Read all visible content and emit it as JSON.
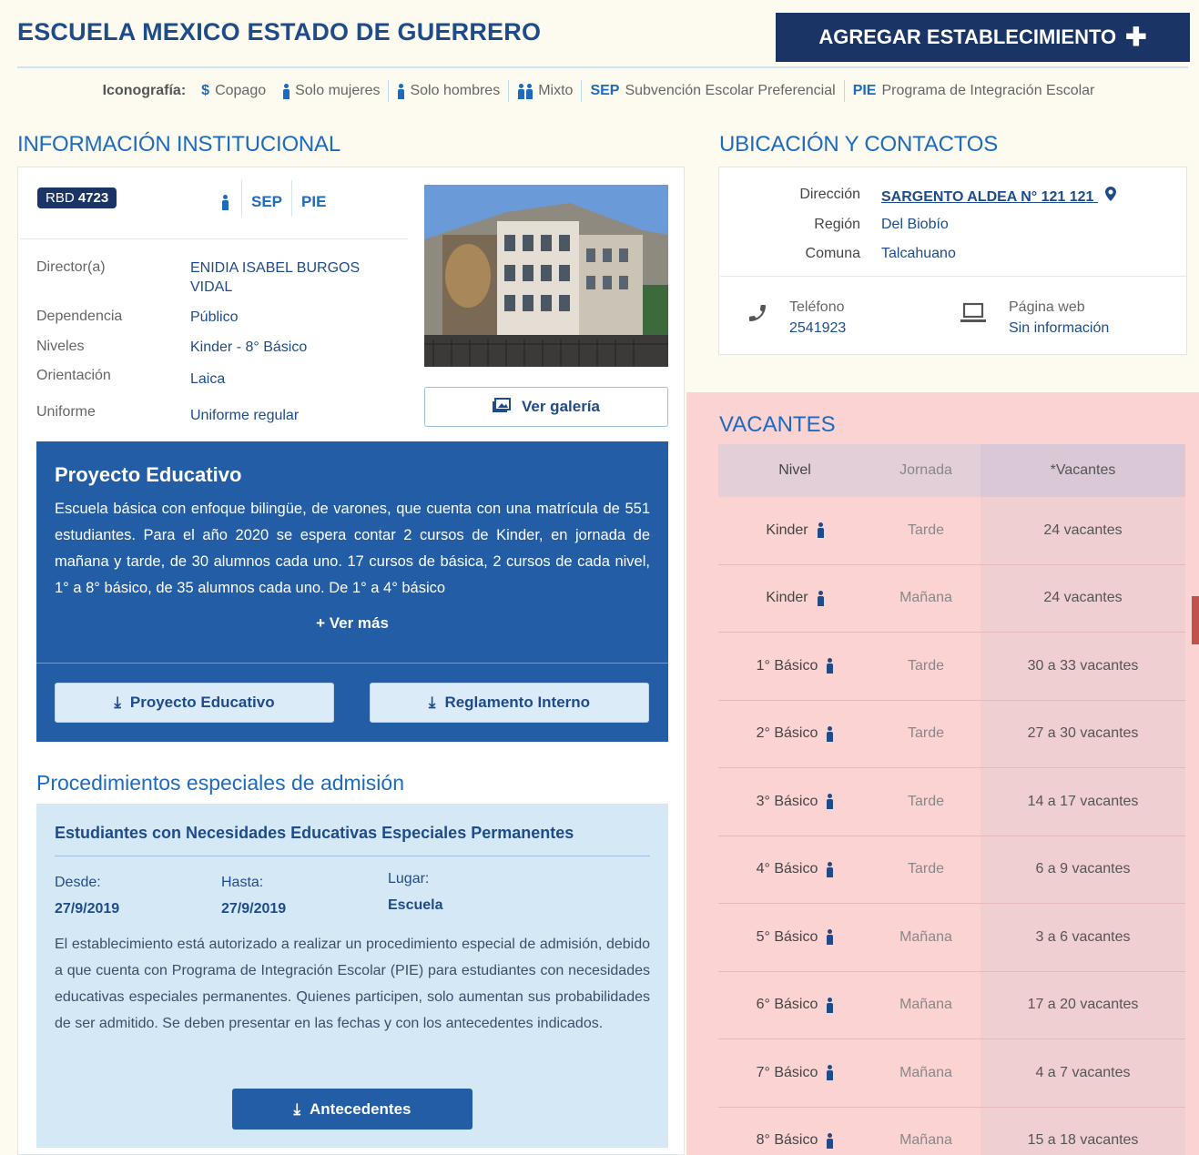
{
  "header": {
    "school_name": "ESCUELA MEXICO ESTADO DE GUERRERO",
    "add_button_label": "AGREGAR ESTABLECIMIENTO"
  },
  "legend": {
    "label": "Iconografía:",
    "copago": "Copago",
    "solo_mujeres": "Solo mujeres",
    "solo_hombres": "Solo hombres",
    "mixto": "Mixto",
    "sep_code": "SEP",
    "sep_text": "Subvención Escolar Preferencial",
    "pie_code": "PIE",
    "pie_text": "Programa de Integración Escolar"
  },
  "institutional": {
    "heading": "INFORMACIÓN INSTITUCIONAL",
    "rbd_label": "RBD",
    "rbd_value": "4723",
    "badge_sep": "SEP",
    "badge_pie": "PIE",
    "rows": [
      {
        "label": "Director(a)",
        "value": "ENIDIA ISABEL BURGOS VIDAL"
      },
      {
        "label": "Dependencia",
        "value": "Público"
      },
      {
        "label": "Niveles",
        "value": "Kinder - 8° Básico"
      },
      {
        "label": "Orientación",
        "value": "Laica"
      },
      {
        "label": "Uniforme",
        "value": "Uniforme regular"
      }
    ],
    "gallery_button": "Ver galería"
  },
  "project": {
    "title": "Proyecto Educativo",
    "text": "Escuela básica con enfoque bilingüe, de varones, que cuenta con una matrícula de 551 estudiantes. Para el año 2020 se espera contar 2 cursos de Kinder, en jornada de mañana y tarde, de 30 alumnos cada uno. 17 cursos de básica, 2 cursos de cada nivel, 1° a 8° básico, de 35 alumnos cada uno. De 1° a 4° básico",
    "more": "+ Ver más",
    "btn_project": "Proyecto Educativo",
    "btn_rules": "Reglamento Interno"
  },
  "procedures": {
    "heading": "Procedimientos especiales de admisión",
    "title": "Estudiantes con Necesidades Educativas Especiales Permanentes",
    "from_label": "Desde:",
    "from_value": "27/9/2019",
    "to_label": "Hasta:",
    "to_value": "27/9/2019",
    "place_label": "Lugar:",
    "place_value": "Escuela",
    "text": "El establecimiento está autorizado a realizar un procedimiento especial de admisión, debido a que cuenta con Programa de Integración Escolar (PIE) para estudiantes con necesidades educativas especiales permanentes. Quienes participen, solo aumentan sus probabilidades de ser admitido. Se deben presentar en las fechas y con los antecedentes indicados.",
    "button": "Antecedentes"
  },
  "contacts": {
    "heading": "UBICACIÓN Y CONTACTOS",
    "address_label": "Dirección",
    "address_value": "SARGENTO ALDEA N° 121 121",
    "region_label": "Región",
    "region_value": "Del Biobío",
    "comuna_label": "Comuna",
    "comuna_value": "Talcahuano",
    "phone_label": "Teléfono",
    "phone_value": "2541923",
    "web_label": "Página web",
    "web_value": "Sin información"
  },
  "vacancies": {
    "heading": "VACANTES",
    "columns": [
      "Nivel",
      "Jornada",
      "*Vacantes"
    ],
    "rows": [
      {
        "level": "Kinder",
        "shift": "Tarde",
        "vacancies": "24 vacantes"
      },
      {
        "level": "Kinder",
        "shift": "Mañana",
        "vacancies": "24 vacantes"
      },
      {
        "level": "1° Básico",
        "shift": "Tarde",
        "vacancies": "30 a 33 vacantes"
      },
      {
        "level": "2° Básico",
        "shift": "Tarde",
        "vacancies": "27 a 30 vacantes"
      },
      {
        "level": "3° Básico",
        "shift": "Tarde",
        "vacancies": "14 a 17 vacantes"
      },
      {
        "level": "4° Básico",
        "shift": "Tarde",
        "vacancies": "6 a 9 vacantes"
      },
      {
        "level": "5° Básico",
        "shift": "Mañana",
        "vacancies": "3 a 6 vacantes"
      },
      {
        "level": "6° Básico",
        "shift": "Mañana",
        "vacancies": "17 a 20 vacantes"
      },
      {
        "level": "7° Básico",
        "shift": "Mañana",
        "vacancies": "4 a 7 vacantes"
      },
      {
        "level": "8° Básico",
        "shift": "Mañana",
        "vacancies": "15 a 18 vacantes"
      }
    ]
  }
}
